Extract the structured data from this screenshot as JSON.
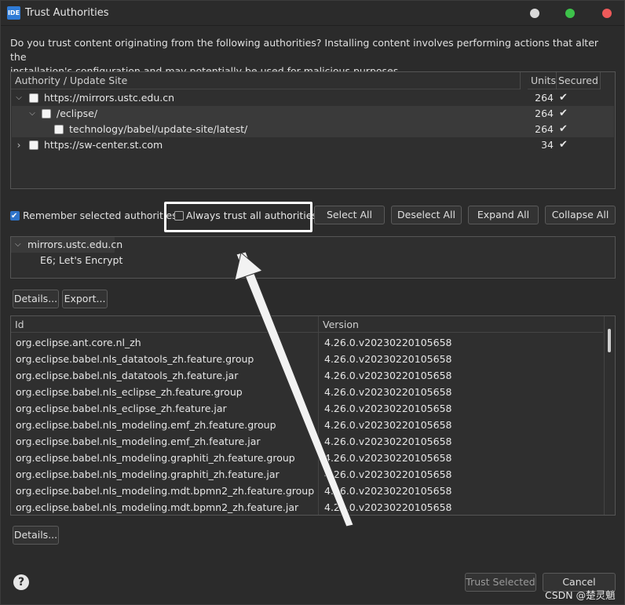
{
  "window": {
    "title": "Trust Authorities",
    "app_icon": "IDE"
  },
  "intro_text_line1": "Do you trust content originating from the following authorities?  Installing content involves performing actions that alter the",
  "intro_text_line2": "installation's configuration and may potentially be used for malicious purposes.",
  "authorities_table": {
    "headers": [
      "Authority / Update Site",
      "Units",
      "Secured"
    ],
    "rows": [
      {
        "label": "https://mirrors.ustc.edu.cn",
        "units": "264",
        "secured": "✔"
      },
      {
        "label": "/eclipse/",
        "units": "264",
        "secured": "✔"
      },
      {
        "label": "technology/babel/update-site/latest/",
        "units": "264",
        "secured": "✔"
      },
      {
        "label": "https://sw-center.st.com",
        "units": "34",
        "secured": "✔"
      }
    ]
  },
  "remember_label": "Remember selected authorities",
  "always_trust_label": "Always trust all authorities",
  "buttons": {
    "select_all": "Select All",
    "deselect_all": "Deselect All",
    "expand_all": "Expand All",
    "collapse_all": "Collapse All",
    "details1": "Details...",
    "export": "Export...",
    "details2": "Details...",
    "trust_selected": "Trust Selected",
    "cancel": "Cancel"
  },
  "certificate_tree": {
    "root": "mirrors.ustc.edu.cn",
    "child": "E6; Let's Encrypt"
  },
  "units_table": {
    "headers": [
      "Id",
      "Version"
    ],
    "rows": [
      {
        "id": "org.eclipse.ant.core.nl_zh",
        "version": "4.26.0.v20230220105658"
      },
      {
        "id": "org.eclipse.babel.nls_datatools_zh.feature.group",
        "version": "4.26.0.v20230220105658"
      },
      {
        "id": "org.eclipse.babel.nls_datatools_zh.feature.jar",
        "version": "4.26.0.v20230220105658"
      },
      {
        "id": "org.eclipse.babel.nls_eclipse_zh.feature.group",
        "version": "4.26.0.v20230220105658"
      },
      {
        "id": "org.eclipse.babel.nls_eclipse_zh.feature.jar",
        "version": "4.26.0.v20230220105658"
      },
      {
        "id": "org.eclipse.babel.nls_modeling.emf_zh.feature.group",
        "version": "4.26.0.v20230220105658"
      },
      {
        "id": "org.eclipse.babel.nls_modeling.emf_zh.feature.jar",
        "version": "4.26.0.v20230220105658"
      },
      {
        "id": "org.eclipse.babel.nls_modeling.graphiti_zh.feature.group",
        "version": "4.26.0.v20230220105658"
      },
      {
        "id": "org.eclipse.babel.nls_modeling.graphiti_zh.feature.jar",
        "version": "4.26.0.v20230220105658"
      },
      {
        "id": "org.eclipse.babel.nls_modeling.mdt.bpmn2_zh.feature.group",
        "version": "4.26.0.v20230220105658"
      },
      {
        "id": "org.eclipse.babel.nls_modeling.mdt.bpmn2_zh.feature.jar",
        "version": "4.26.0.v20230220105658"
      }
    ]
  },
  "watermark": "CSDN @楚灵魈",
  "colors": {
    "accent": "#2e73c9",
    "background": "#2b2b2b",
    "panel": "#2f2f2f"
  }
}
